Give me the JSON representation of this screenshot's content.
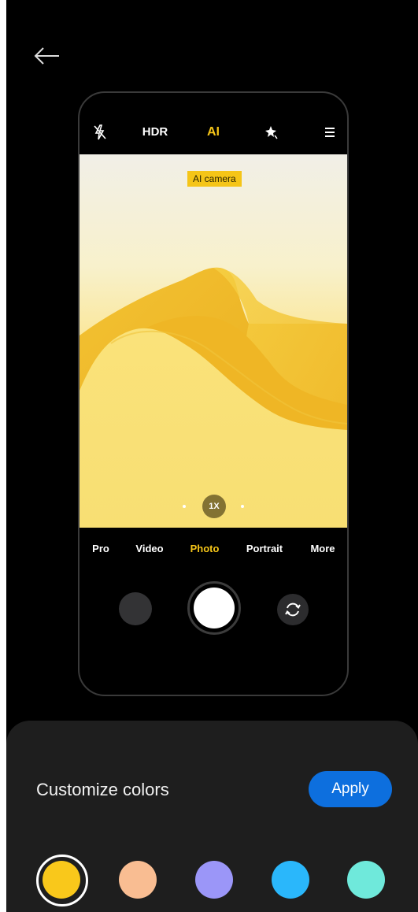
{
  "camera": {
    "topbar": {
      "hdr_label": "HDR",
      "ai_label": "AI"
    },
    "viewfinder": {
      "ai_badge": "AI camera",
      "zoom_label": "1X"
    },
    "modes": [
      "Pro",
      "Video",
      "Photo",
      "Portrait",
      "More"
    ],
    "active_mode": "Photo"
  },
  "sheet": {
    "title": "Customize colors",
    "apply_label": "Apply",
    "swatches": [
      "#f9c81b",
      "#f9bd92",
      "#9b96f8",
      "#2ab7fb",
      "#6fe9db"
    ],
    "selected_swatch": 0
  },
  "colors": {
    "accent_yellow": "#f5c518",
    "apply_blue": "#0d6fde",
    "sheet_background": "#1e1e1e"
  },
  "icons": {
    "back": "arrow-left-icon",
    "flash": "flash-off-icon",
    "beauty": "sparkle-icon",
    "menu": "menu-icon",
    "switch": "camera-switch-icon"
  }
}
